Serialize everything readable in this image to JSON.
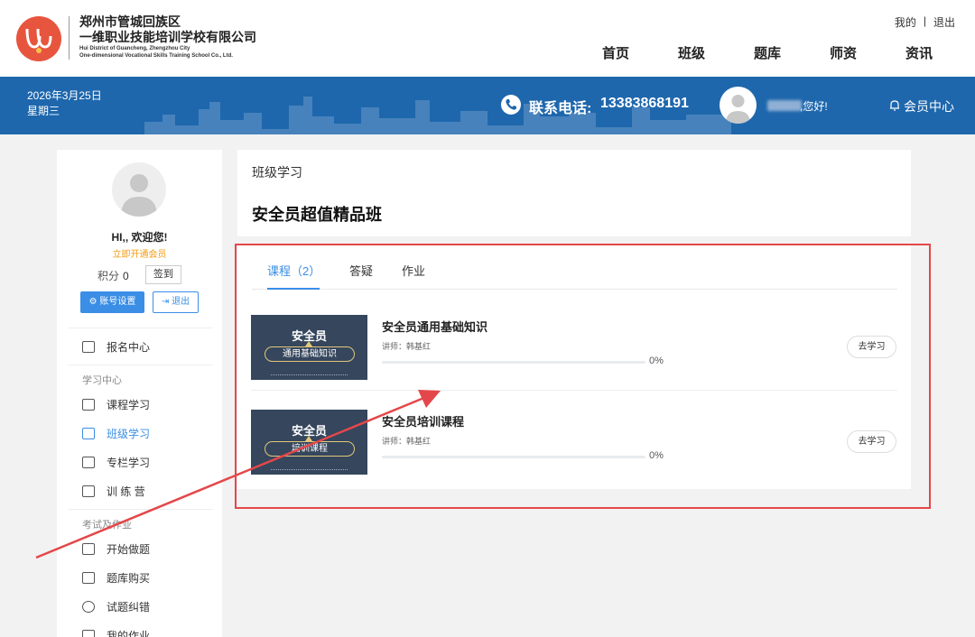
{
  "header": {
    "brand_line1": "郑州市管城回族区",
    "brand_line2": "一维职业技能培训学校有限公司",
    "brand_en1": "Hui District of Guancheng, Zhengzhou City",
    "brand_en2": "One-dimensional Vocational Skills Training School Co., Ltd.",
    "top_links": [
      "我的",
      "退出"
    ],
    "nav": [
      "首页",
      "班级",
      "题库",
      "师资",
      "资讯"
    ]
  },
  "banner": {
    "date": "2026年3月25日",
    "weekday": "星期三",
    "phone_label": "联系电话:",
    "phone_number": "13383868191",
    "greeting": ",您好!",
    "member_center": "会员中心"
  },
  "sidebar": {
    "hello": "HI,, 欢迎您!",
    "vip": "立即开通会员",
    "points_label": "积分",
    "points_value": "0",
    "sign_in": "签到",
    "settings_button": "账号设置",
    "logout_button": "退出",
    "enroll": "报名中心",
    "group_study": "学习中心",
    "study_items": [
      "课程学习",
      "班级学习",
      "专栏学习",
      "训 练 营"
    ],
    "group_exam": "考试及作业",
    "exam_items": [
      "开始做题",
      "题库购买",
      "试题纠错",
      "我的作业"
    ]
  },
  "main": {
    "breadcrumb": "班级学习",
    "title": "安全员超值精品班",
    "tabs": [
      "课程（2）",
      "答疑",
      "作业"
    ],
    "courses": [
      {
        "thumb_title": "安全员",
        "thumb_sub": "通用基础知识",
        "name": "安全员通用基础知识",
        "teacher": "讲师：韩基红",
        "progress": "0%",
        "go": "去学习"
      },
      {
        "thumb_title": "安全员",
        "thumb_sub": "培训课程",
        "name": "安全员培训课程",
        "teacher": "讲师：韩基红",
        "progress": "0%",
        "go": "去学习"
      }
    ]
  },
  "colors": {
    "banner": "#1e67ad",
    "accent": "#3a8ee6",
    "annotation": "#e4474a",
    "vip": "#f39c12"
  }
}
